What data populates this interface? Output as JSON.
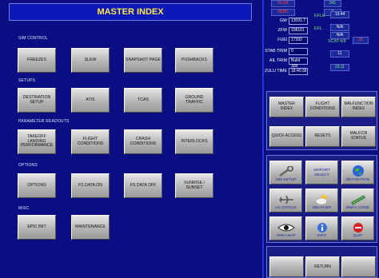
{
  "title": "MASTER INDEX",
  "sections": {
    "sim_control": "SIM CONTROL",
    "setups": "SETUPS",
    "parameter_readouts": "PARAMETER READOUTS",
    "options": "OPTIONS",
    "misc": "MISC"
  },
  "buttons": {
    "freezes": "FREEZES",
    "slew": "SLEW",
    "snapshot_page": "SNAPSHOT PAGE",
    "pushbacks": "PUSHBACKS",
    "destination_setup": "DESTINATION\nSETUP",
    "atis": "ATIS",
    "tcas": "TCAS",
    "ground_traffic": "GROUND TRAFFIC",
    "takeoff_landing_performance": "TAKEOFF\nLANDING\nPERFORMANCE",
    "flight_conditions": "FLIGHT\nCONDITIONS",
    "crash_conditions": "CRASH\nCONDITIONS",
    "interlocks": "INTERLOCKS",
    "options": "OPTIONS",
    "fs_data_on": "FS DATA ON",
    "fs_data_off": "FS DATA OFF",
    "sunrise_sunset": "SUNRISE /\nSUNSET",
    "epic_init": "EPIC INIT",
    "maintenance": "MAINTENANCE"
  },
  "readouts": {
    "gw_label": "GW",
    "gw_value": "13091.7",
    "zfw_label": "ZFW",
    "zfw_value": "108161",
    "fuel_label": "FUEl",
    "fuel_value": "17392",
    "stab_trim_label": "STAB TRIM",
    "stab_trim_value": "0",
    "ail_trim_label": "AIL TRIM",
    "ail_trim_value": "Build 309",
    "zulu_time_label": "ZULU TIME",
    "zulu_time_value": "18:40:38",
    "top_red_1": "KLGB",
    "top_red_2": "N5BD",
    "top_right_1": "341",
    "top_right_2": "0",
    "g_13_44": "13:44",
    "g_n_a": "N/A",
    "g_n_a_2": "N/A",
    "scat_label": "SCAT",
    "scat_value": "4/8",
    "g_11": "11",
    "r_25": "25",
    "g_2911": "29.11",
    "g_ef_1": "EFLE",
    "g_ef_2": "EFL"
  },
  "menu": {
    "master_index": "MASTER\nINDEX",
    "flight_conditions": "FLIGHT\nCONDITIONS",
    "malfunction_index": "MALFUNCTION\nINDEX",
    "quick_access": "QUICK ACCESS",
    "resets": "RESETS",
    "malf_cb_status": "MALF/CB\nSTATUS"
  },
  "nav": {
    "sim_setup": "SIM SETUP",
    "airport_select": "AIRPORT\nSELECT",
    "reposition": "REPOSITION",
    "ac_status": "AC STATUS",
    "weather": "WEATHER",
    "rwy_cond": "RWAY COND",
    "area_map": "AREA MAP",
    "info": "INFO",
    "quit": "QUIT"
  },
  "bottom": {
    "return": "RETURN"
  },
  "colors": {
    "background": "#0a0e82",
    "title_text": "#ffe84a",
    "green_readout": "#7be07b",
    "red_readout": "#ff4040"
  }
}
